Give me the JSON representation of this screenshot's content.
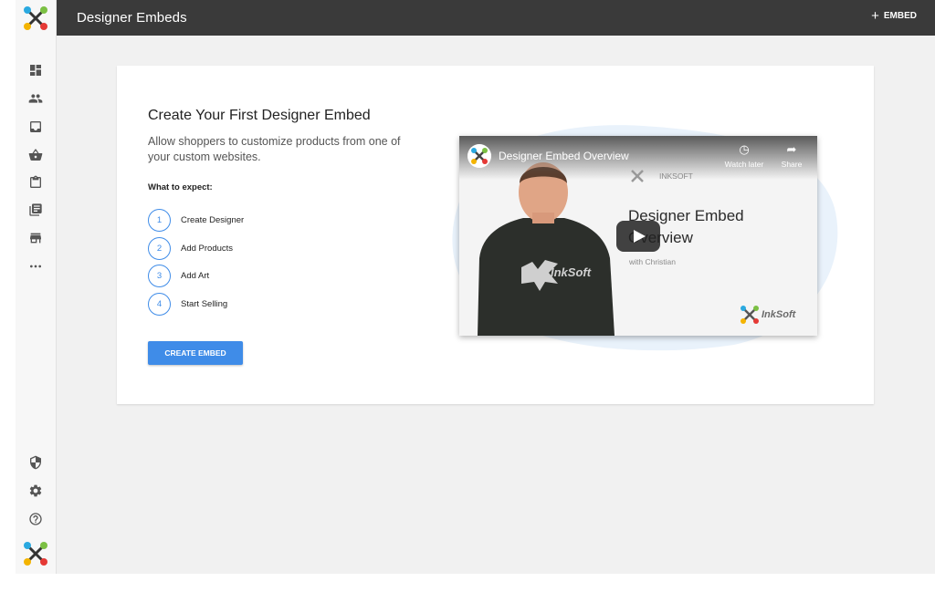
{
  "topbar": {
    "title": "Designer Embeds",
    "add_button_label": "EMBED"
  },
  "sidebar": {
    "items": [
      {
        "icon": "dashboard-icon"
      },
      {
        "icon": "people-icon"
      },
      {
        "icon": "inbox-icon"
      },
      {
        "icon": "basket-icon"
      },
      {
        "icon": "clipboard-icon"
      },
      {
        "icon": "library-icon"
      },
      {
        "icon": "store-icon"
      },
      {
        "icon": "more-icon"
      }
    ],
    "bottom_items": [
      {
        "icon": "shield-icon"
      },
      {
        "icon": "gear-icon"
      },
      {
        "icon": "help-icon"
      }
    ]
  },
  "card": {
    "title": "Create Your First Designer Embed",
    "description": "Allow shoppers to customize products from one of your custom websites.",
    "expect_heading": "What to expect:",
    "steps": [
      {
        "number": "1",
        "label": "Create Designer"
      },
      {
        "number": "2",
        "label": "Add Products"
      },
      {
        "number": "3",
        "label": "Add Art"
      },
      {
        "number": "4",
        "label": "Start Selling"
      }
    ],
    "cta_label": "CREATE EMBED"
  },
  "video": {
    "title": "Designer Embed Overview",
    "watch_later": "Watch later",
    "share": "Share",
    "brand_small": "INKSOFT",
    "headline": "Designer Embed Overview",
    "subline": "with Christian",
    "brand_logo": "InkSoft"
  },
  "colors": {
    "accent": "#3f8ce8",
    "topbar": "#3a3a3a",
    "background": "#f1f1f1"
  }
}
